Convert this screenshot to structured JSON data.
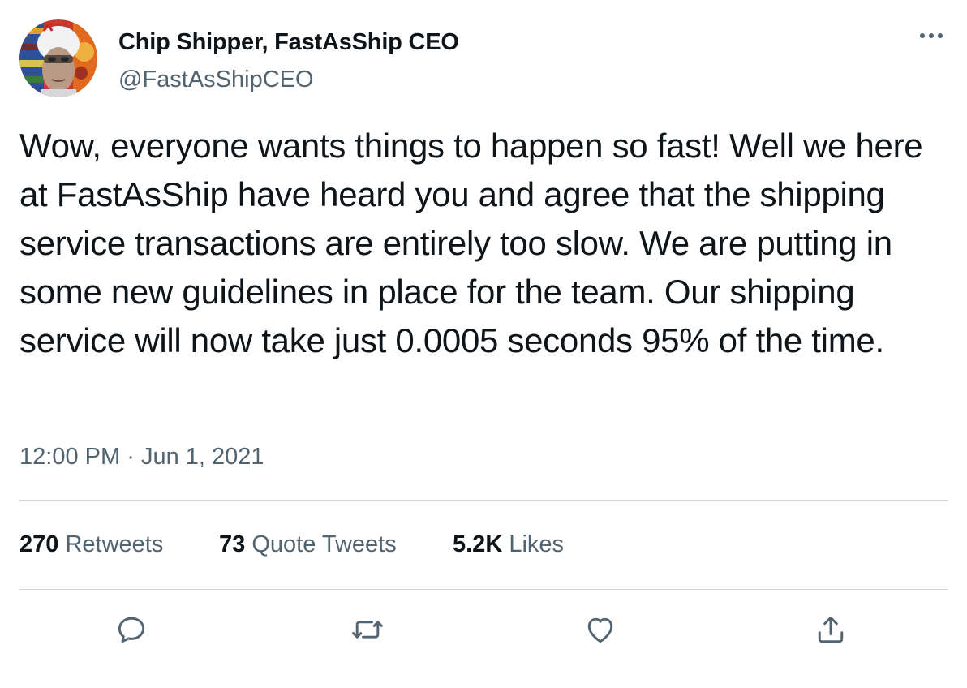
{
  "author": {
    "display_name": "Chip Shipper, FastAsShip CEO",
    "handle": "@FastAsShipCEO",
    "avatar_icon": "profile-photo"
  },
  "tweet": {
    "text": "Wow, everyone wants things to happen so fast! Well we here at FastAsShip have heard you and agree that the shipping service transactions are entirely too slow. We are putting in some new guidelines in place for the team. Our shipping service will now take just 0.0005 seconds 95% of the time.",
    "time": "12:00 PM",
    "separator": "·",
    "date": "Jun 1, 2021"
  },
  "stats": {
    "retweets_count": "270",
    "retweets_label": "Retweets",
    "quotes_count": "73",
    "quotes_label": "Quote Tweets",
    "likes_count": "5.2K",
    "likes_label": "Likes"
  },
  "actions": [
    "reply-icon",
    "retweet-icon",
    "like-icon",
    "share-icon"
  ],
  "colors": {
    "text_primary": "#0f1419",
    "text_secondary": "#536471",
    "divider": "#cfd9de",
    "background": "#ffffff"
  }
}
